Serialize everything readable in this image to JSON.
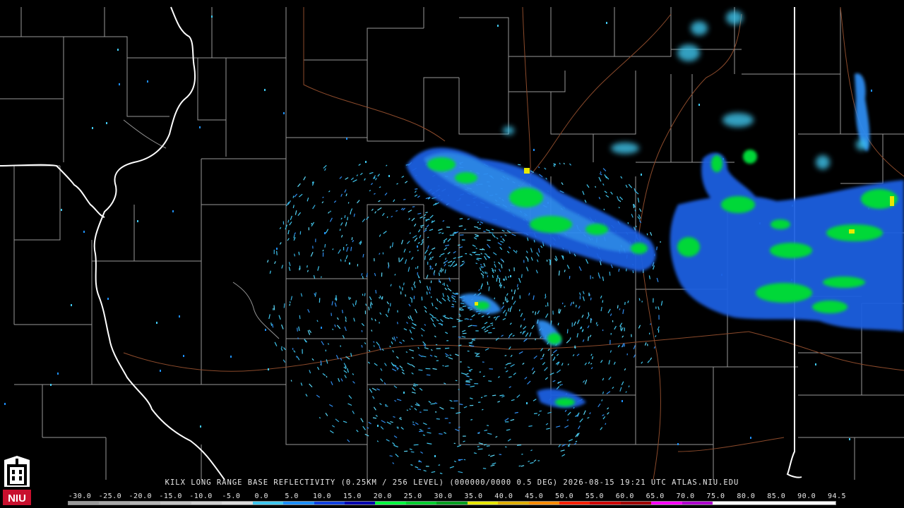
{
  "caption": "KILX LONG RANGE BASE REFLECTIVITY (0.25KM / 256 LEVEL) (000000/0000 0.5 DEG) 2026-08-15 19:21 UTC  ATLAS.NIU.EDU",
  "logo": {
    "text": "NIU",
    "icon": "university-tower-icon",
    "color": "#c8102e"
  },
  "colorbar": {
    "labels": [
      "-30.0",
      "-25.0",
      "-20.0",
      "-15.0",
      "-10.0",
      "-5.0",
      "0.0",
      "5.0",
      "10.0",
      "15.0",
      "20.0",
      "25.0",
      "30.0",
      "35.0",
      "40.0",
      "45.0",
      "50.0",
      "55.0",
      "60.0",
      "65.0",
      "70.0",
      "75.0",
      "80.0",
      "85.0",
      "90.0",
      "94.5"
    ],
    "colors": [
      "#9a9a9a",
      "#a8a8a8",
      "#b6b6b6",
      "#c4c4c4",
      "#d0d0d0",
      "#dcdcdc",
      "#40c8f0",
      "#1e90ff",
      "#1040e0",
      "#0000b0",
      "#00ff40",
      "#00d030",
      "#00a020",
      "#e8e800",
      "#e0b000",
      "#ff8c00",
      "#ff2000",
      "#d00000",
      "#a00000",
      "#ff00ff",
      "#b000d0",
      "#ffffff",
      "#ffffff",
      "#ffffff",
      "#ffffff"
    ]
  },
  "map": {
    "background": "#000000",
    "county_line_color": "#a8a8a8",
    "state_line_color": "#ffffff",
    "road_color": "#8b4a2b"
  }
}
